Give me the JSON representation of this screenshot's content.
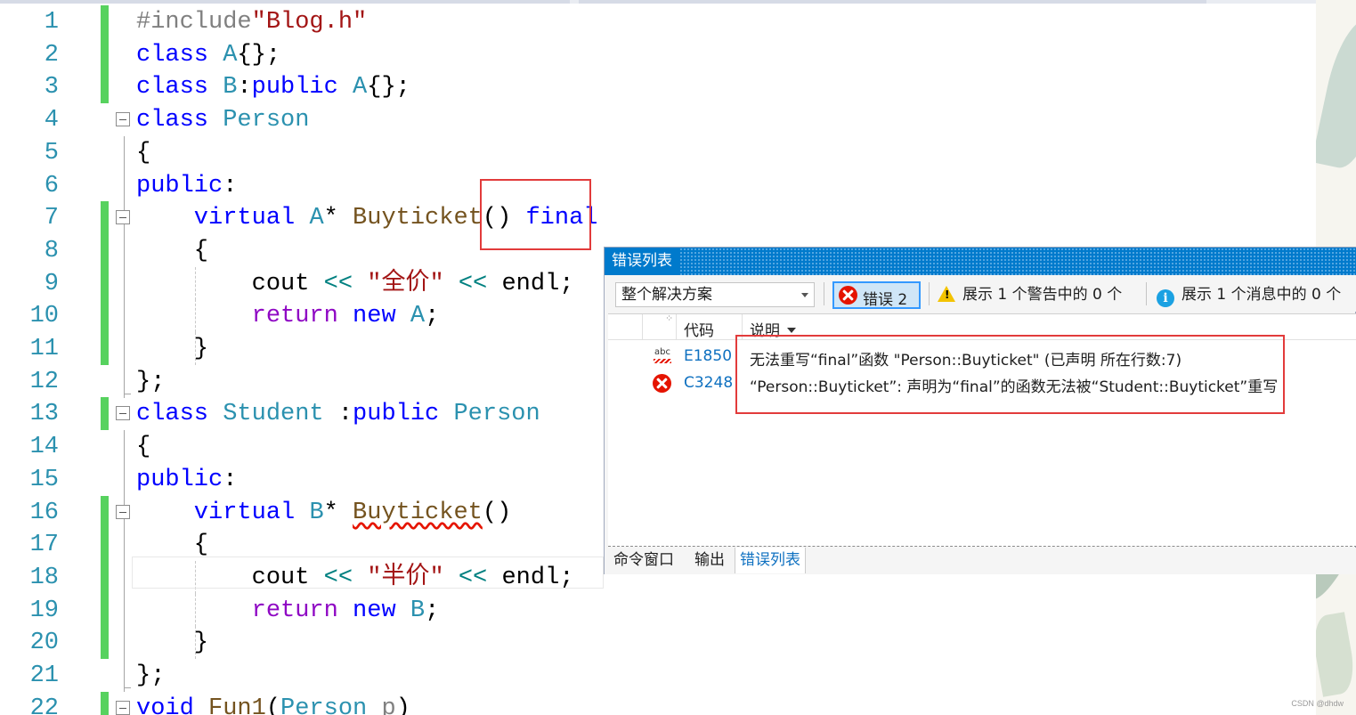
{
  "editor": {
    "lines": [
      {
        "n": "1",
        "tokens": [
          {
            "t": "#include",
            "c": "pp"
          },
          {
            "t": "\"Blog.h\"",
            "c": "s"
          }
        ]
      },
      {
        "n": "2",
        "tokens": [
          {
            "t": "class ",
            "c": "k"
          },
          {
            "t": "A",
            "c": "t"
          },
          {
            "t": "{};",
            "c": "p"
          }
        ]
      },
      {
        "n": "3",
        "tokens": [
          {
            "t": "class ",
            "c": "k"
          },
          {
            "t": "B",
            "c": "t"
          },
          {
            "t": ":",
            "c": "p"
          },
          {
            "t": "public ",
            "c": "k"
          },
          {
            "t": "A",
            "c": "t"
          },
          {
            "t": "{};",
            "c": "p"
          }
        ]
      },
      {
        "n": "4",
        "tokens": [
          {
            "t": "class ",
            "c": "k"
          },
          {
            "t": "Person",
            "c": "t"
          }
        ]
      },
      {
        "n": "5",
        "tokens": [
          {
            "t": "{",
            "c": "p"
          }
        ]
      },
      {
        "n": "6",
        "tokens": [
          {
            "t": "public",
            "c": "k"
          },
          {
            "t": ":",
            "c": "p"
          }
        ]
      },
      {
        "n": "7",
        "tokens": [
          {
            "t": "    virtual ",
            "c": "k"
          },
          {
            "t": "A",
            "c": "t"
          },
          {
            "t": "* ",
            "c": "p"
          },
          {
            "t": "Buyticket",
            "c": "f"
          },
          {
            "t": "() ",
            "c": "p"
          },
          {
            "t": "final",
            "c": "k"
          }
        ]
      },
      {
        "n": "8",
        "tokens": [
          {
            "t": "    {",
            "c": "p"
          }
        ]
      },
      {
        "n": "9",
        "tokens": [
          {
            "t": "        cout ",
            "c": "p"
          },
          {
            "t": "<<",
            "c": "op"
          },
          {
            "t": " ",
            "c": "p"
          },
          {
            "t": "\"全价\"",
            "c": "s"
          },
          {
            "t": " ",
            "c": "p"
          },
          {
            "t": "<<",
            "c": "op"
          },
          {
            "t": " endl;",
            "c": "p"
          }
        ]
      },
      {
        "n": "10",
        "tokens": [
          {
            "t": "        ",
            "c": "p"
          },
          {
            "t": "return ",
            "c": "kc"
          },
          {
            "t": "new ",
            "c": "k"
          },
          {
            "t": "A",
            "c": "t"
          },
          {
            "t": ";",
            "c": "p"
          }
        ]
      },
      {
        "n": "11",
        "tokens": [
          {
            "t": "    }",
            "c": "p"
          }
        ]
      },
      {
        "n": "12",
        "tokens": [
          {
            "t": "};",
            "c": "p"
          }
        ]
      },
      {
        "n": "13",
        "tokens": [
          {
            "t": "class ",
            "c": "k"
          },
          {
            "t": "Student ",
            "c": "t"
          },
          {
            "t": ":",
            "c": "p"
          },
          {
            "t": "public ",
            "c": "k"
          },
          {
            "t": "Person",
            "c": "t"
          }
        ]
      },
      {
        "n": "14",
        "tokens": [
          {
            "t": "{",
            "c": "p"
          }
        ]
      },
      {
        "n": "15",
        "tokens": [
          {
            "t": "public",
            "c": "k"
          },
          {
            "t": ":",
            "c": "p"
          }
        ]
      },
      {
        "n": "16",
        "tokens": [
          {
            "t": "    virtual ",
            "c": "k"
          },
          {
            "t": "B",
            "c": "t"
          },
          {
            "t": "* ",
            "c": "p"
          },
          {
            "t": "Buyticket",
            "c": "f sq"
          },
          {
            "t": "()",
            "c": "p"
          }
        ]
      },
      {
        "n": "17",
        "tokens": [
          {
            "t": "    {",
            "c": "p"
          }
        ]
      },
      {
        "n": "18",
        "tokens": [
          {
            "t": "        cout ",
            "c": "p"
          },
          {
            "t": "<<",
            "c": "op"
          },
          {
            "t": " ",
            "c": "p"
          },
          {
            "t": "\"半价\"",
            "c": "s"
          },
          {
            "t": " ",
            "c": "p"
          },
          {
            "t": "<<",
            "c": "op"
          },
          {
            "t": " endl;",
            "c": "p"
          }
        ]
      },
      {
        "n": "19",
        "tokens": [
          {
            "t": "        ",
            "c": "p"
          },
          {
            "t": "return ",
            "c": "kc"
          },
          {
            "t": "new ",
            "c": "k"
          },
          {
            "t": "B",
            "c": "t"
          },
          {
            "t": ";",
            "c": "p"
          }
        ]
      },
      {
        "n": "20",
        "tokens": [
          {
            "t": "    }",
            "c": "p"
          }
        ]
      },
      {
        "n": "21",
        "tokens": [
          {
            "t": "};",
            "c": "p"
          }
        ]
      },
      {
        "n": "22",
        "tokens": [
          {
            "t": "void ",
            "c": "k"
          },
          {
            "t": "Fun1",
            "c": "f"
          },
          {
            "t": "(",
            "c": "p"
          },
          {
            "t": "Person ",
            "c": "t"
          },
          {
            "t": "p",
            "c": "pp"
          },
          {
            "t": ")",
            "c": "p"
          }
        ]
      }
    ]
  },
  "error_list": {
    "title": "错误列表",
    "scope": "整个解决方案",
    "errors_button": "错误 2",
    "warnings_button": "展示 1 个警告中的 0 个",
    "messages_button": "展示 1 个消息中的 0 个",
    "columns": {
      "code": "代码",
      "description": "说明"
    },
    "rows": [
      {
        "icon": "intellisense-error-icon",
        "badge": "abc",
        "code": "E1850",
        "description": "无法重写“final”函数 \"Person::Buyticket\" (已声明 所在行数:7)"
      },
      {
        "icon": "error-icon",
        "code": "C3248",
        "description": "“Person::Buyticket”: 声明为“final”的函数无法被“Student::Buyticket”重写"
      }
    ],
    "tabs": [
      "命令窗口",
      "输出",
      "错误列表"
    ],
    "active_tab": "错误列表"
  },
  "watermark": "CSDN @dhdw",
  "colors": {
    "keyword": "#0000ff",
    "type": "#2b91af",
    "string": "#a31515",
    "function": "#74531f",
    "line_number": "#2b91af",
    "change_bar": "#57d25f",
    "title_bar": "#007acc",
    "highlight_box": "#e23b3b",
    "error_red": "#e51400"
  }
}
